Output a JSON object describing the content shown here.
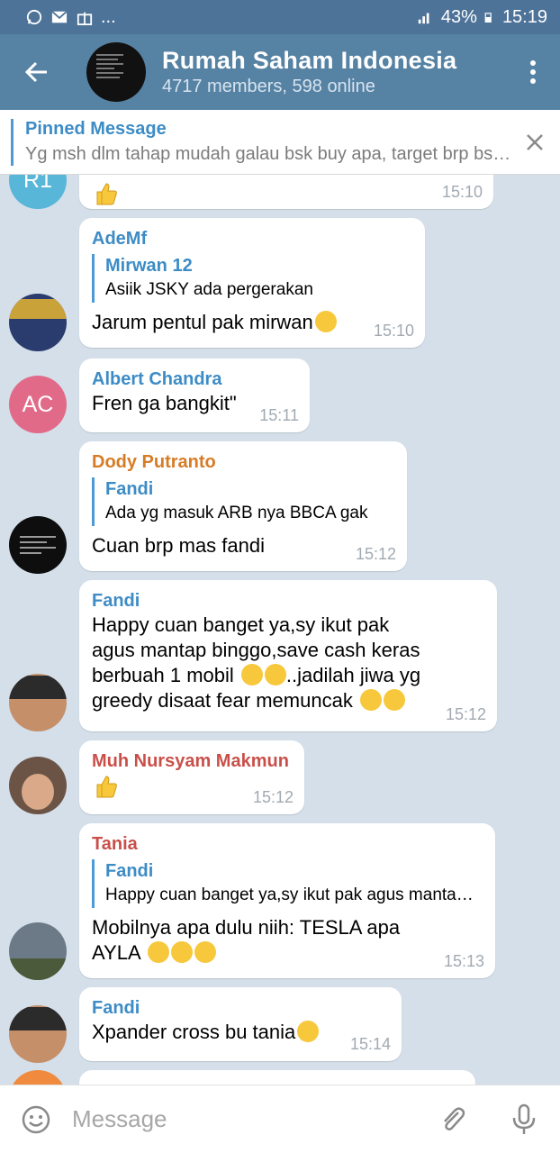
{
  "status": {
    "battery": "43%",
    "time": "15:19",
    "dots": "..."
  },
  "header": {
    "title": "Rumah Saham Indonesia",
    "subtitle": "4717 members, 598 online"
  },
  "pinned": {
    "label": "Pinned Message",
    "text": "Yg msh dlm tahap mudah galau bsk buy apa, target brp bsk?"
  },
  "messages": [
    {
      "avatar_initials": "R1",
      "avatar_color": "#58b6d8",
      "time": "15:10"
    },
    {
      "name": "AdeMf",
      "name_color": "#3d8cc6",
      "quote_name": "Mirwan 12",
      "quote_text": "Asiik JSKY ada pergerakan",
      "text": "Jarum pentul pak mirwan",
      "time": "15:10"
    },
    {
      "name": "Albert Chandra",
      "name_color": "#3d8cc6",
      "avatar_initials": "AC",
      "avatar_color": "#e26a89",
      "text": "Fren ga bangkit\"",
      "time": "15:11"
    },
    {
      "name": "Dody Putranto",
      "name_color": "#d77c26",
      "quote_name": "Fandi",
      "quote_text": "Ada yg masuk ARB nya BBCA gak",
      "text": "Cuan brp mas fandi",
      "time": "15:12"
    },
    {
      "name": "Fandi",
      "name_color": "#3d8cc6",
      "text_lines": [
        "Happy cuan banget ya,sy ikut pak",
        "agus mantap binggo,save cash keras",
        "berbuah 1 mobil",
        "..jadilah jiwa yg",
        "greedy disaat fear memuncak"
      ],
      "time": "15:12"
    },
    {
      "name": "Muh Nursyam Makmun",
      "name_color": "#c9504a",
      "time": "15:12"
    },
    {
      "name": "Tania",
      "name_color": "#c9504a",
      "quote_name": "Fandi",
      "quote_text": "Happy cuan banget ya,sy ikut pak agus mantap binggo",
      "text_lines": [
        "Mobilnya apa dulu  niih: TESLA apa",
        "AYLA"
      ],
      "time": "15:13"
    },
    {
      "name": "Fandi",
      "name_color": "#3d8cc6",
      "text": "Xpander cross bu tania",
      "time": "15:14"
    }
  ],
  "composer": {
    "placeholder": "Message"
  },
  "icons": [
    "whatsapp-icon",
    "mail-icon",
    "gift-icon",
    "signal-icon",
    "battery-icon",
    "back-arrow-icon",
    "more-vert-icon",
    "close-icon",
    "emoji-icon",
    "attach-icon",
    "mic-icon",
    "thumbs-up-icon",
    "smile-emoji-icon"
  ],
  "colors": {
    "header": "#5682a3",
    "statusbar": "#4e7399",
    "chat_bg": "#d4dfe9",
    "accent": "#3d8cc6"
  }
}
